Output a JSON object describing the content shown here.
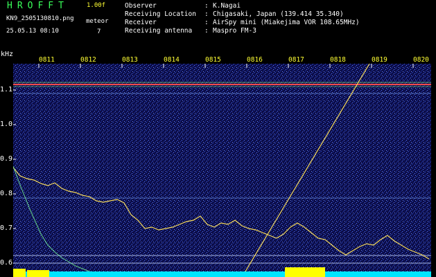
{
  "header": {
    "app_name": "HROFFT",
    "version": "1.00f",
    "filename": "KN9_2505130810.png",
    "datetime": "25.05.13 08:10",
    "meteor_label": "meteor",
    "meteor_count": "7"
  },
  "info": [
    {
      "key": "Observer",
      "sep": ":",
      "value": "K.Nagai"
    },
    {
      "key": "Receiving Location",
      "sep": ":",
      "value": "Chigasaki, Japan (139.414 35.340)"
    },
    {
      "key": "Receiver",
      "sep": ":",
      "value": "AirSpy mini (Miakejima VOR 108.65MHz)"
    },
    {
      "key": "Receiving antenna",
      "sep": ":",
      "value": "Maspro FM-3"
    }
  ],
  "axes": {
    "unit": "kHz",
    "y_ticks": [
      "1.1",
      "1.0",
      "0.9",
      "0.8",
      "0.7",
      "0.6"
    ],
    "x_ticks": [
      "0811",
      "0812",
      "0813",
      "0814",
      "0815",
      "0816",
      "0817",
      "0818",
      "0819",
      "0820"
    ]
  },
  "colors": {
    "background": "#0a0a3a",
    "noise": "#2a48c8",
    "carrier": "#ff4a4a",
    "trace": "#f5d95a",
    "scale_bar": "#00e5ff",
    "meteor": "#ffff00"
  }
}
